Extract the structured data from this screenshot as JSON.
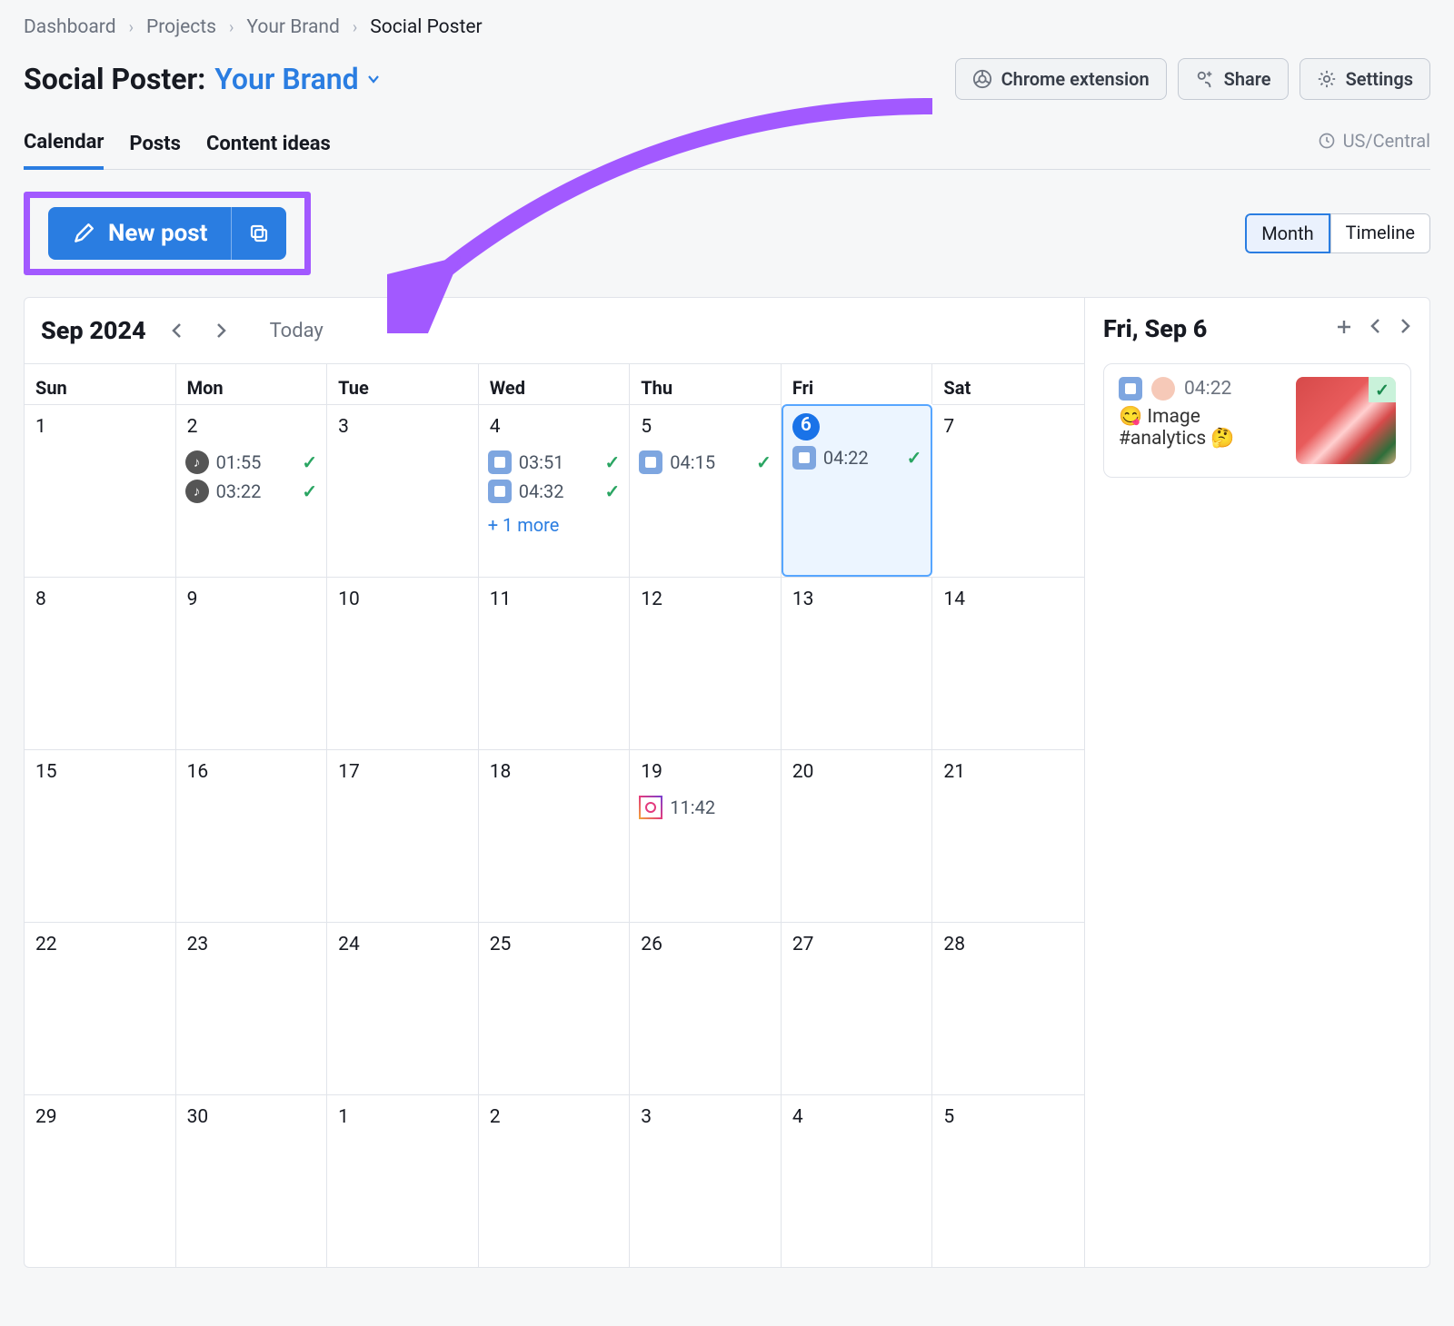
{
  "breadcrumbs": [
    "Dashboard",
    "Projects",
    "Your Brand",
    "Social Poster"
  ],
  "header": {
    "title_prefix": "Social Poster:",
    "brand": "Your Brand",
    "actions": {
      "chrome": "Chrome extension",
      "share": "Share",
      "settings": "Settings"
    }
  },
  "tabs": {
    "calendar": "Calendar",
    "posts": "Posts",
    "content_ideas": "Content ideas",
    "timezone": "US/Central"
  },
  "toolbar": {
    "new_post": "New post",
    "view_month": "Month",
    "view_timeline": "Timeline",
    "active_view": "Month"
  },
  "calendar": {
    "title": "Sep 2024",
    "today_label": "Today",
    "dow": [
      "Sun",
      "Mon",
      "Tue",
      "Wed",
      "Thu",
      "Fri",
      "Sat"
    ],
    "selected_day": 6,
    "weeks": [
      [
        {
          "n": "1"
        },
        {
          "n": "2",
          "events": [
            {
              "platform": "tiktok",
              "time": "01:55",
              "done": true
            },
            {
              "platform": "tiktok",
              "time": "03:22",
              "done": true
            }
          ]
        },
        {
          "n": "3"
        },
        {
          "n": "4",
          "events": [
            {
              "platform": "gmb",
              "time": "03:51",
              "done": true
            },
            {
              "platform": "gmb",
              "time": "04:32",
              "done": true
            }
          ],
          "more": "+ 1 more"
        },
        {
          "n": "5",
          "events": [
            {
              "platform": "gmb",
              "time": "04:15",
              "done": true
            }
          ]
        },
        {
          "n": "6",
          "selected": true,
          "events": [
            {
              "platform": "gmb",
              "time": "04:22",
              "done": true
            }
          ]
        },
        {
          "n": "7"
        }
      ],
      [
        {
          "n": "8"
        },
        {
          "n": "9"
        },
        {
          "n": "10"
        },
        {
          "n": "11"
        },
        {
          "n": "12"
        },
        {
          "n": "13"
        },
        {
          "n": "14"
        }
      ],
      [
        {
          "n": "15"
        },
        {
          "n": "16"
        },
        {
          "n": "17"
        },
        {
          "n": "18"
        },
        {
          "n": "19",
          "events": [
            {
              "platform": "instagram",
              "time": "11:42"
            }
          ]
        },
        {
          "n": "20"
        },
        {
          "n": "21"
        }
      ],
      [
        {
          "n": "22"
        },
        {
          "n": "23"
        },
        {
          "n": "24"
        },
        {
          "n": "25"
        },
        {
          "n": "26"
        },
        {
          "n": "27"
        },
        {
          "n": "28"
        }
      ],
      [
        {
          "n": "29"
        },
        {
          "n": "30"
        },
        {
          "n": "1"
        },
        {
          "n": "2"
        },
        {
          "n": "3"
        },
        {
          "n": "4"
        },
        {
          "n": "5"
        }
      ]
    ]
  },
  "sidebar": {
    "title": "Fri, Sep 6",
    "card": {
      "time": "04:22",
      "text": "😋 Image #analytics 🤔",
      "platforms": [
        "gmb",
        "pinterest"
      ],
      "status": "done"
    }
  },
  "annotation": {
    "highlight_target": "new-post-button"
  }
}
